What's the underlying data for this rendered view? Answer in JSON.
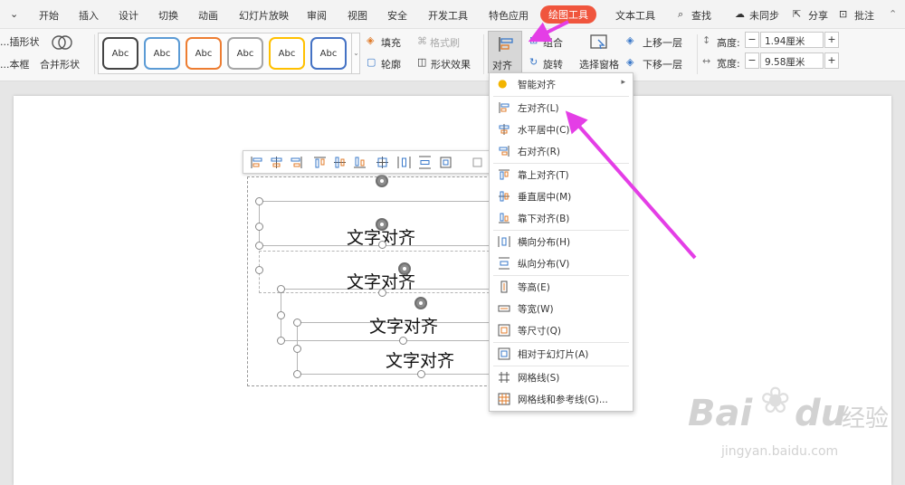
{
  "menu": {
    "items": [
      "开始",
      "插入",
      "设计",
      "切换",
      "动画",
      "幻灯片放映",
      "审阅",
      "视图",
      "安全",
      "开发工具",
      "特色应用",
      "绘图工具",
      "文本工具",
      "查找"
    ],
    "right": {
      "sync": "未同步",
      "share": "分享",
      "annotate": "批注"
    }
  },
  "ribbon": {
    "left_top": "...插形状",
    "left_bottom": "...本框",
    "merge_shape": "合并形状",
    "style_label": "Abc",
    "fill": "填充",
    "format_brush": "格式刷",
    "outline": "轮廓",
    "shape_effect": "形状效果",
    "align": "对齐",
    "group": "组合",
    "rotate": "旋转",
    "selection_pane": "选择窗格",
    "bring_forward": "上移一层",
    "send_backward": "下移一层",
    "height_label": "高度:",
    "height_value": "1.94厘米",
    "width_label": "宽度:",
    "width_value": "9.58厘米"
  },
  "slide": {
    "box_text": "文字对齐"
  },
  "dropdown": {
    "items": [
      {
        "label": "智能对齐",
        "icon": "lightbulb-icon",
        "has_arrow": true
      },
      {
        "label": "左对齐(L)",
        "icon": "align-left-icon"
      },
      {
        "label": "水平居中(C)",
        "icon": "align-center-icon"
      },
      {
        "label": "右对齐(R)",
        "icon": "align-right-icon"
      },
      {
        "label": "靠上对齐(T)",
        "icon": "align-top-icon"
      },
      {
        "label": "垂直居中(M)",
        "icon": "align-middle-icon"
      },
      {
        "label": "靠下对齐(B)",
        "icon": "align-bottom-icon"
      },
      {
        "label": "横向分布(H)",
        "icon": "distribute-horizontal-icon"
      },
      {
        "label": "纵向分布(V)",
        "icon": "distribute-vertical-icon"
      },
      {
        "label": "等高(E)",
        "icon": "same-height-icon"
      },
      {
        "label": "等宽(W)",
        "icon": "same-width-icon"
      },
      {
        "label": "等尺寸(Q)",
        "icon": "same-size-icon"
      },
      {
        "label": "相对于幻灯片(A)",
        "icon": "relative-to-slide-icon"
      },
      {
        "label": "网格线(S)",
        "icon": "gridlines-icon"
      },
      {
        "label": "网格线和参考线(G)...",
        "icon": "grid-guides-icon"
      }
    ]
  },
  "watermark": {
    "brand": "Bai",
    "brand2": "du",
    "cn": "经验",
    "url": "jingyan.baidu.com"
  },
  "colors": {
    "accent": "#f0553d",
    "arrow": "#e43ee6",
    "icon_blue": "#3a78c9",
    "icon_orange": "#e07b2a"
  }
}
